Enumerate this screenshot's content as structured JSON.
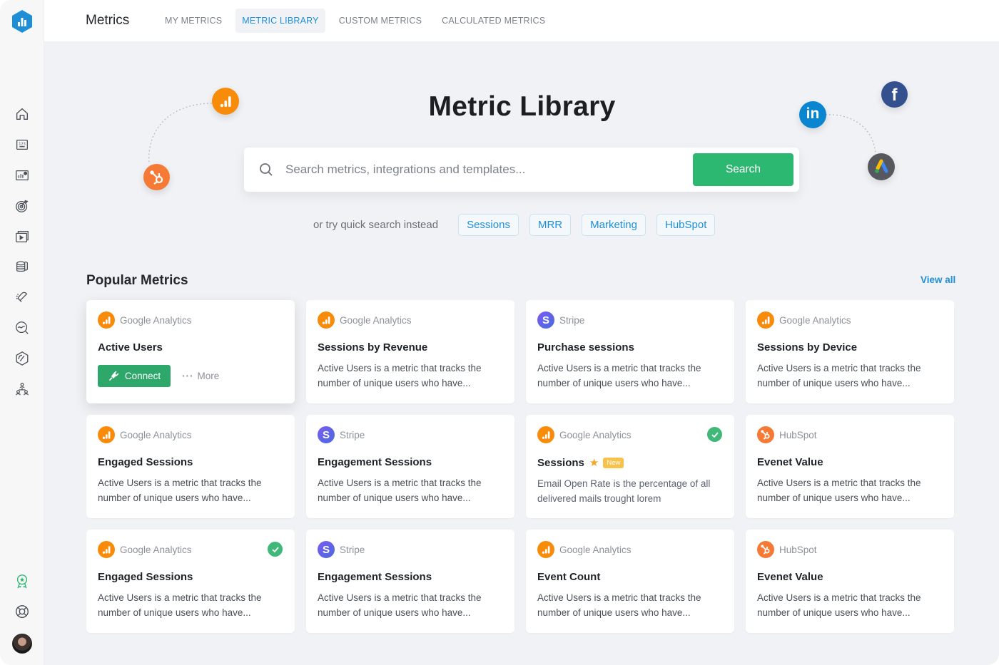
{
  "app": {
    "title": "Metrics"
  },
  "tabs": [
    {
      "label": "MY METRICS",
      "active": false
    },
    {
      "label": "METRIC LIBRARY",
      "active": true
    },
    {
      "label": "CUSTOM METRICS",
      "active": false
    },
    {
      "label": "CALCULATED METRICS",
      "active": false
    }
  ],
  "sidebar": {
    "items": [
      {
        "icon": "home-icon"
      },
      {
        "icon": "number-card-icon"
      },
      {
        "icon": "dashboard-icon"
      },
      {
        "icon": "goals-target-icon"
      },
      {
        "icon": "video-slides-icon"
      },
      {
        "icon": "data-stack-icon"
      },
      {
        "icon": "alert-bell-icon"
      },
      {
        "icon": "trend-search-icon"
      },
      {
        "icon": "gauge-icon"
      },
      {
        "icon": "team-icon"
      }
    ],
    "bottom": [
      {
        "icon": "rewards-badge-icon",
        "color": "#2db872"
      },
      {
        "icon": "help-lifebuoy-icon"
      },
      {
        "icon": "user-avatar"
      }
    ]
  },
  "hero": {
    "title": "Metric Library",
    "search_placeholder": "Search metrics, integrations and templates...",
    "search_value": "",
    "search_button": "Search",
    "quick_label": "or try quick search instead",
    "quick_chips": [
      "Sessions",
      "MRR",
      "Marketing",
      "HubSpot"
    ],
    "floating_logos": [
      "google-analytics",
      "hubspot",
      "linkedin",
      "facebook",
      "google-ads"
    ]
  },
  "popular": {
    "title": "Popular Metrics",
    "view_all": "View all",
    "cards": [
      {
        "source": "Google Analytics",
        "src": "ga",
        "title": "Active Users",
        "desc": "",
        "connected": false,
        "raised": true,
        "actions": {
          "connect": "Connect",
          "more": "More"
        }
      },
      {
        "source": "Google Analytics",
        "src": "ga",
        "title": "Sessions by Revenue",
        "desc": "Active Users is a metric that tracks the number of unique users who have...",
        "connected": false
      },
      {
        "source": "Stripe",
        "src": "stripe",
        "title": "Purchase sessions",
        "desc": "Active Users is a metric that tracks the number of unique users who have...",
        "connected": false
      },
      {
        "source": "Google Analytics",
        "src": "ga",
        "title": "Sessions by Device",
        "desc": "Active Users is a metric that tracks the number of unique users who have...",
        "connected": false
      },
      {
        "source": "Google Analytics",
        "src": "ga",
        "title": "Engaged Sessions",
        "desc": "Active Users is a metric that tracks the number of unique users who have...",
        "connected": false
      },
      {
        "source": "Stripe",
        "src": "stripe",
        "title": "Engagement Sessions",
        "desc": "Active Users is a metric that tracks the number of unique users who have...",
        "connected": false
      },
      {
        "source": "Google Analytics",
        "src": "ga",
        "title": "Sessions",
        "desc": "Email Open Rate is the percentage of all delivered mails trought lorem",
        "connected": true,
        "starred": true,
        "badge": "New"
      },
      {
        "source": "HubSpot",
        "src": "hubspot",
        "title": "Evenet Value",
        "desc": "Active Users is a metric that tracks the number of unique users who have...",
        "connected": false
      },
      {
        "source": "Google Analytics",
        "src": "ga",
        "title": "Engaged Sessions",
        "desc": "Active Users is a metric that tracks the number of unique users who have...",
        "connected": true
      },
      {
        "source": "Stripe",
        "src": "stripe",
        "title": "Engagement Sessions",
        "desc": "Active Users is a metric that tracks the number of unique users who have...",
        "connected": false
      },
      {
        "source": "Google Analytics",
        "src": "ga",
        "title": "Event Count",
        "desc": "Active Users is a metric that tracks the number of unique users who have...",
        "connected": false
      },
      {
        "source": "HubSpot",
        "src": "hubspot",
        "title": "Evenet Value",
        "desc": "Active Users is a metric that tracks the number of unique users who have...",
        "connected": false
      }
    ]
  },
  "colors": {
    "accent_blue": "#1e8fd6",
    "primary_green": "#2db872",
    "connect_green": "#2da76a",
    "ga_orange": "#f98b0b",
    "hubspot_orange": "#f57a35",
    "stripe_purple": "#6a5be0",
    "linkedin_blue": "#0a86d0",
    "facebook_blue": "#3b5998",
    "new_badge": "#f8c14b",
    "star": "#f5a623"
  }
}
